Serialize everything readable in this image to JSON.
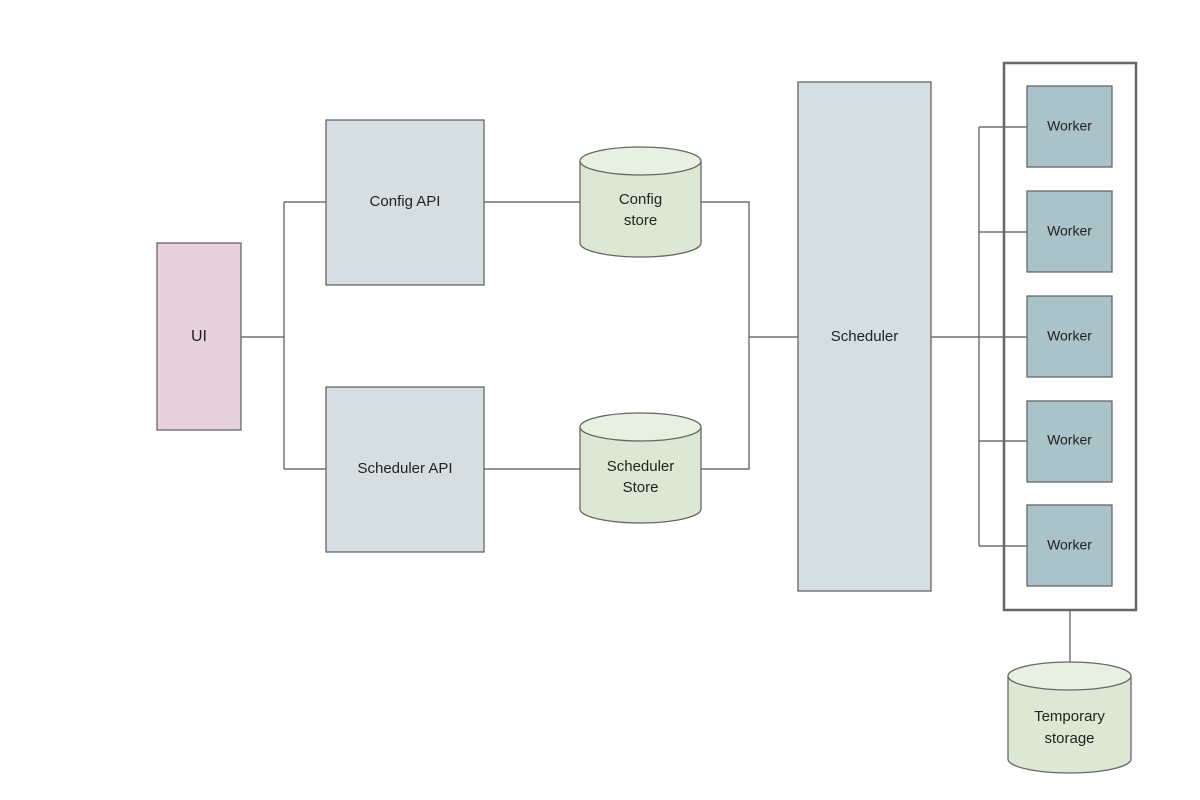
{
  "nodes": {
    "ui": {
      "label": "UI"
    },
    "config_api": {
      "label": "Config API"
    },
    "scheduler_api": {
      "label": "Scheduler API"
    },
    "config_store": {
      "line1": "Config",
      "line2": "store"
    },
    "scheduler_store": {
      "line1": "Scheduler",
      "line2": "Store"
    },
    "scheduler": {
      "label": "Scheduler"
    },
    "workers": [
      {
        "label": "Worker"
      },
      {
        "label": "Worker"
      },
      {
        "label": "Worker"
      },
      {
        "label": "Worker"
      },
      {
        "label": "Worker"
      }
    ],
    "temporary_storage": {
      "line1": "Temporary",
      "line2": "storage"
    }
  },
  "colors": {
    "ui": "#e6d1dd",
    "api": "#d5dfe1",
    "store": "#dde8d4",
    "store_top": "#e8f0e2",
    "worker": "#aac3c8"
  }
}
